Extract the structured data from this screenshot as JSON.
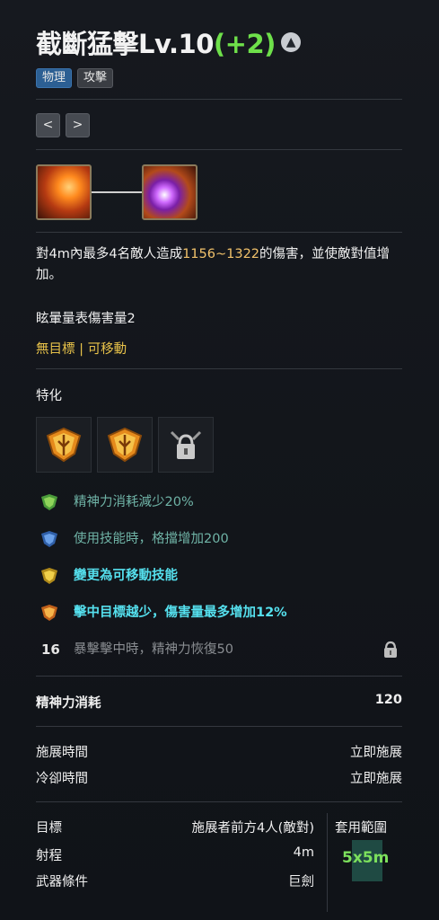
{
  "skill": {
    "name": "截斷猛擊Lv.10",
    "level_bonus": "(+2)",
    "tags": [
      "物理",
      "攻擊"
    ]
  },
  "nav": {
    "prev": "<",
    "next": ">"
  },
  "description": {
    "prefix": "對4m內最多4名敵人造成",
    "damage_range": "1156~1322",
    "suffix": "的傷害，並使敵對值增加。"
  },
  "stun_text": "眩暈量表傷害量2",
  "mobility_text": "無目標 | 可移動",
  "specialization": {
    "title": "特化",
    "effects": [
      {
        "text": "精神力消耗減少20%"
      },
      {
        "text": "使用技能時，格擋增加200"
      },
      {
        "text": "變更為可移動技能"
      },
      {
        "text": "擊中目標越少，傷害量最多增加12%"
      },
      {
        "level": "16",
        "text": "暴擊擊中時，精神力恢復50"
      }
    ]
  },
  "stats": {
    "mana_label": "精神力消耗",
    "mana_value": "120",
    "cast_label": "施展時間",
    "cast_value": "立即施展",
    "cooldown_label": "冷卻時間",
    "cooldown_value": "立即施展",
    "target_label": "目標",
    "target_value": "施展者前方4人(敵對)",
    "range_label": "射程",
    "range_value": "4m",
    "weapon_label": "武器條件",
    "weapon_value": "巨劍",
    "area_label": "套用範圍",
    "area_value": "5x5m"
  },
  "colors": {
    "accent_green": "#6ee04a",
    "damage_orange": "#f2c26b",
    "mobility_yellow": "#e8c24a",
    "effect_cyan": "#55e0ee"
  }
}
